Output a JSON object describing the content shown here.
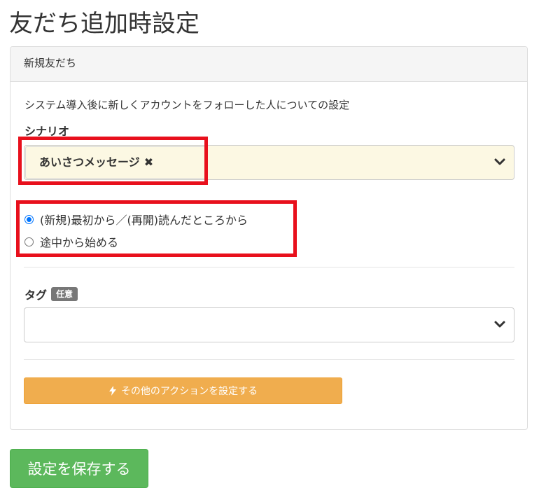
{
  "page": {
    "title": "友だち追加時設定"
  },
  "panel": {
    "heading": "新規友だち",
    "description": "システム導入後に新しくアカウントをフォローした人についての設定",
    "scenario": {
      "label": "シナリオ",
      "selected_chip": "あいさつメッセージ",
      "chip_remove_icon": "✖"
    },
    "start_options": [
      {
        "label": "(新規)最初から／(再開)読んだところから",
        "checked": true
      },
      {
        "label": "途中から始める",
        "checked": false
      }
    ],
    "tag": {
      "label": "タグ",
      "badge": "任意",
      "value": ""
    },
    "action_button": "その他のアクションを設定する"
  },
  "save_button": "設定を保存する",
  "colors": {
    "highlight": "#e8101c",
    "warning": "#f0ad4e",
    "success": "#5cb85c",
    "selected_bg": "#fcf8e3",
    "radio_accent": "#0075ff"
  },
  "icons": {
    "select_arrow": "chevron-down-icon",
    "remove": "close-icon",
    "action": "bolt-icon"
  }
}
